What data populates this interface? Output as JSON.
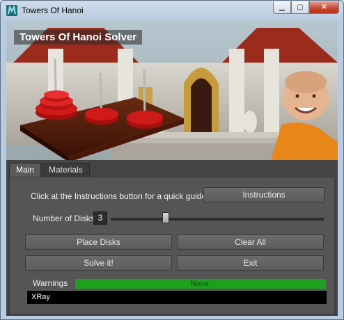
{
  "window": {
    "title": "Towers Of Hanoi",
    "minimize_icon": "minimize-icon",
    "maximize_icon": "maximize-icon",
    "close_icon": "close-icon"
  },
  "banner": {
    "title": "Towers Of Hanoi Solver"
  },
  "tabs": [
    {
      "label": "Main",
      "active": true
    },
    {
      "label": "Materials",
      "active": false
    }
  ],
  "main": {
    "instructions_text": "Click at the Instructions button for a quick guide -",
    "instructions_button": "Instructions",
    "disks_label": "Number of Disks:",
    "disks_value": "3",
    "disks_slider_fraction": 0.25,
    "place_disks": "Place Disks",
    "clear_all": "Clear All",
    "solve": "Solve it!",
    "exit": "Exit",
    "warnings_label": "Warnings",
    "warnings_value": "None.",
    "xray": "XRay"
  },
  "colors": {
    "accent_green": "#1ea01e",
    "panel_bg": "#555555",
    "disk_red": "#d01a1a"
  }
}
